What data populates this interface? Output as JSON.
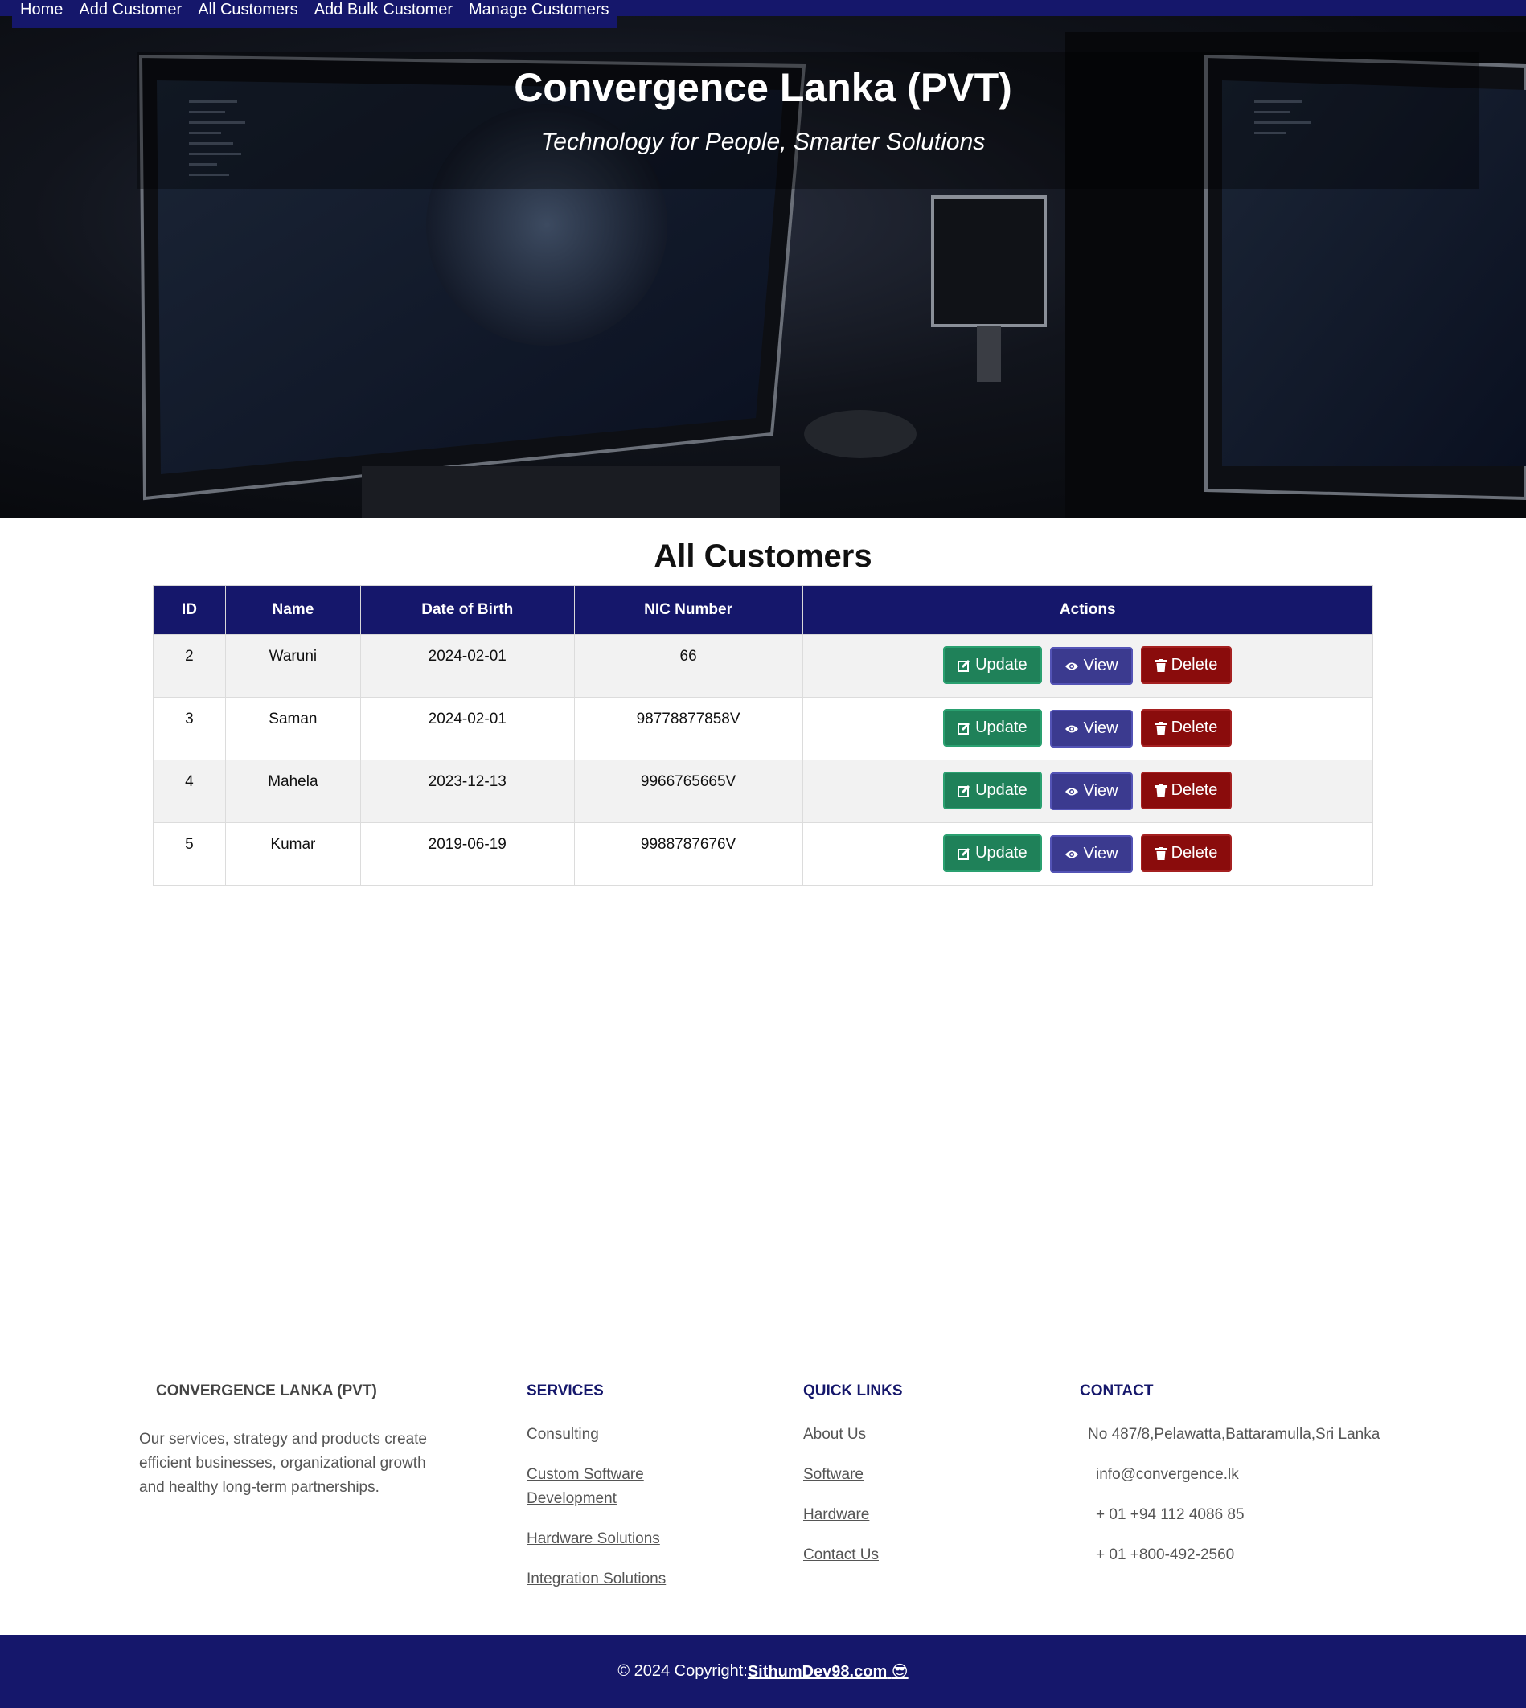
{
  "nav": {
    "items": [
      "Home",
      "Add Customer",
      "All Customers",
      "Add Bulk Customer",
      "Manage Customers"
    ]
  },
  "hero": {
    "title": "Convergence Lanka (PVT)",
    "subtitle": "Technology for People, Smarter Solutions"
  },
  "page": {
    "title": "All Customers"
  },
  "table": {
    "headers": [
      "ID",
      "Name",
      "Date of Birth",
      "NIC Number",
      "Actions"
    ],
    "rows": [
      {
        "id": "2",
        "name": "Waruni",
        "dob": "2024-02-01",
        "nic": "66"
      },
      {
        "id": "3",
        "name": "Saman",
        "dob": "2024-02-01",
        "nic": "98778877858V"
      },
      {
        "id": "4",
        "name": "Mahela",
        "dob": "2023-12-13",
        "nic": "9966765665V"
      },
      {
        "id": "5",
        "name": "Kumar",
        "dob": "2019-06-19",
        "nic": "9988787676V"
      }
    ],
    "actions": {
      "update": "Update",
      "view": "View",
      "delete": "Delete"
    }
  },
  "footer": {
    "company": {
      "heading": "CONVERGENCE LANKA (PVT)",
      "about": "Our services, strategy and products create efficient businesses, organizational growth and healthy long-term partnerships."
    },
    "services": {
      "heading": "SERVICES",
      "items": [
        "Consulting",
        "Custom Software Development",
        "Hardware Solutions",
        "Integration Solutions"
      ]
    },
    "quick_links": {
      "heading": "QUICK LINKS",
      "items": [
        "About Us",
        "Software",
        "Hardware",
        "Contact Us"
      ]
    },
    "contact": {
      "heading": "CONTACT",
      "address": "No 487/8,Pelawatta,Battaramulla,Sri Lanka",
      "email": "info@convergence.lk",
      "phone1": "+ 01 +94 112 4086 85",
      "phone2": "+ 01 +800-492-2560"
    },
    "copyright_prefix": "© 2024 Copyright:",
    "copyright_link": "SithumDev98.com",
    "copyright_emoji": "😎"
  },
  "colors": {
    "brand_navy": "#15176b",
    "update_green": "#1f8159",
    "view_purple": "#3b3a8f",
    "delete_red": "#8a0c0c"
  }
}
